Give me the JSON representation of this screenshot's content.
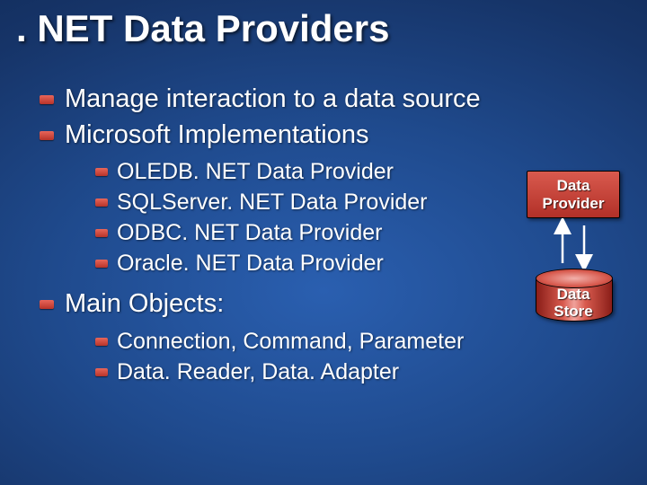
{
  "title": ". NET Data Providers",
  "bullets": {
    "b0": "Manage interaction to a data source",
    "b1": "Microsoft Implementations",
    "b1_sub": {
      "s0": "OLEDB. NET Data Provider",
      "s1": "SQLServer. NET Data Provider",
      "s2": "ODBC. NET Data Provider",
      "s3": "Oracle. NET Data Provider"
    },
    "b2": "Main Objects:",
    "b2_sub": {
      "s0": "Connection, Command, Parameter",
      "s1": "Data. Reader, Data. Adapter"
    }
  },
  "diagram": {
    "box_line1": "Data",
    "box_line2": "Provider",
    "cyl_line1": "Data",
    "cyl_line2": "Store"
  },
  "colors": {
    "accent": "#c6483e",
    "bg_center": "#2a5fb0",
    "bg_edge": "#0d234a"
  }
}
